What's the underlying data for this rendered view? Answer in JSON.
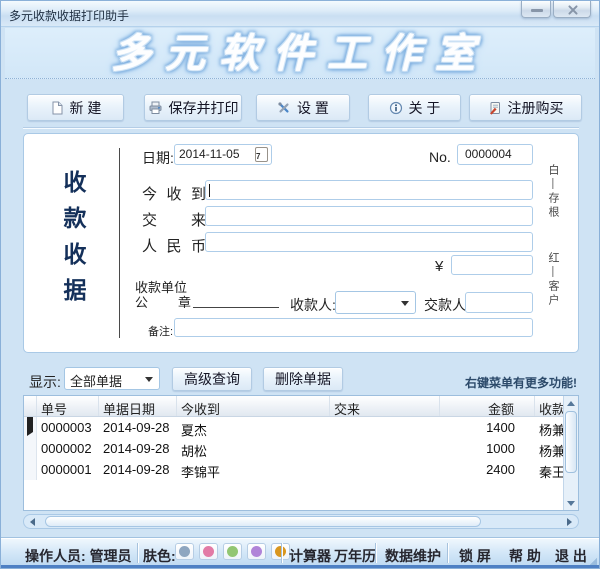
{
  "window": {
    "title": "多元收款收据打印助手"
  },
  "banner": {
    "text": "多元软件工作室"
  },
  "toolbar": {
    "new": "新 建",
    "save_print": "保存并打印",
    "settings": "设 置",
    "about": "关 于",
    "register": "注册购买"
  },
  "receipt": {
    "side_title": "收款收据",
    "date_label": "日期:",
    "date_value": "2014-11-05",
    "date_icon_day": "7",
    "no_label": "No.",
    "no_value": "0000004",
    "received_label": "今收到",
    "handover_label": "交来",
    "currency_label": "人民币",
    "yen": "¥",
    "unit_line1": "收款单位",
    "unit_line2": "公章",
    "payee_label": "收款人:",
    "payer_label": "交款人:",
    "remark_label": "备注:",
    "note_white": "白—存根",
    "note_red": "红—客户"
  },
  "list": {
    "display_label": "显示:",
    "filter_value": "全部单据",
    "advanced_button": "高级查询",
    "delete_button": "删除单据",
    "hint": "右键菜单有更多功能!",
    "columns": {
      "id": "单号",
      "date": "单据日期",
      "received": "今收到",
      "from": "交来",
      "amount": "金额",
      "payee": "收款"
    },
    "rows": [
      {
        "id": "0000003",
        "date": "2014-09-28",
        "received": "夏杰",
        "from": "",
        "amount": "1400",
        "payee": "杨兼"
      },
      {
        "id": "0000002",
        "date": "2014-09-28",
        "received": "胡松",
        "from": "",
        "amount": "1000",
        "payee": "杨兼"
      },
      {
        "id": "0000001",
        "date": "2014-09-28",
        "received": "李锦平",
        "from": "",
        "amount": "2400",
        "payee": "秦王"
      }
    ]
  },
  "statusbar": {
    "operator_label": "操作人员:",
    "operator_value": "管理员",
    "skin_label": "肤色:",
    "skin_colors": [
      "#8ea6c0",
      "#e27ba6",
      "#92c672",
      "#b084d8",
      "#d9961e"
    ],
    "calculator": "计算器",
    "calendar": "万年历",
    "maintenance": "数据维护",
    "lock": "锁 屏",
    "help": "帮 助",
    "exit": "退 出"
  }
}
